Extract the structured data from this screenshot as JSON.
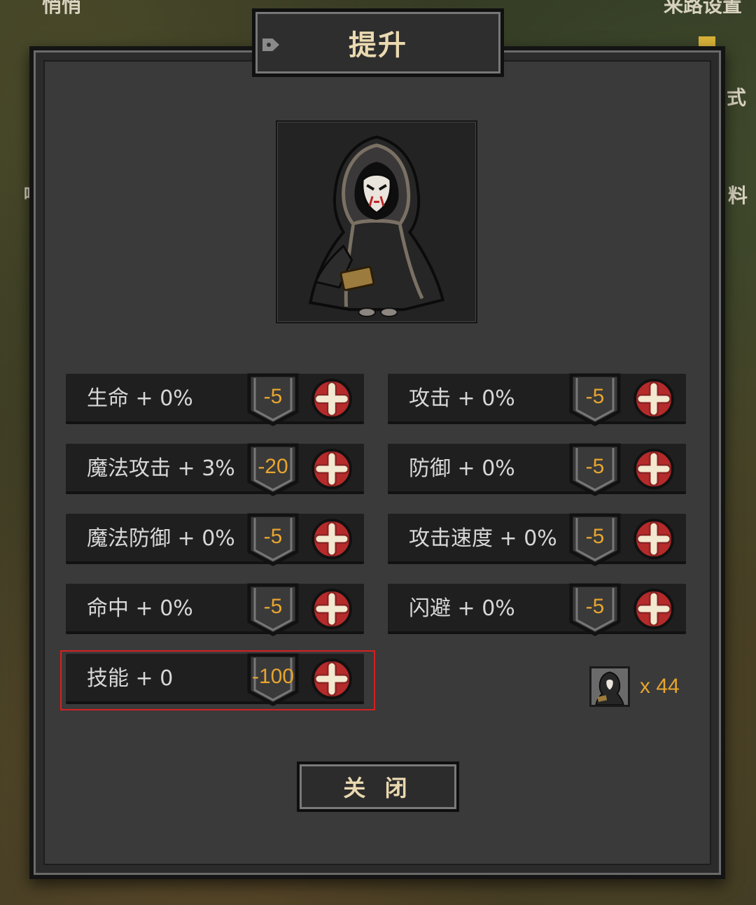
{
  "background": {
    "top_left_text": "悄悄",
    "top_right_text": "来路设置",
    "right_text_1": "式",
    "right_text_2": "料",
    "left_text_1": "喵"
  },
  "dialog": {
    "title": "提升",
    "portrait_icon": "hooded-masked-character",
    "stats": [
      {
        "label": "生命 + 0%",
        "cost": "-5"
      },
      {
        "label": "攻击 + 0%",
        "cost": "-5"
      },
      {
        "label": "魔法攻击 + 3%",
        "cost": "-20"
      },
      {
        "label": "防御 + 0%",
        "cost": "-5"
      },
      {
        "label": "魔法防御 + 0%",
        "cost": "-5"
      },
      {
        "label": "攻击速度 + 0%",
        "cost": "-5"
      },
      {
        "label": "命中 + 0%",
        "cost": "-5"
      },
      {
        "label": "闪避 + 0%",
        "cost": "-5"
      },
      {
        "label": "技能 + 0",
        "cost": "-100"
      }
    ],
    "currency": {
      "icon": "character-token-icon",
      "count": "x 44"
    },
    "close_label": "关 闭"
  },
  "colors": {
    "cost": "#e8a52e",
    "plus_button": "#b52a2a",
    "highlight": "#d42020",
    "title_text": "#ead9b0"
  }
}
